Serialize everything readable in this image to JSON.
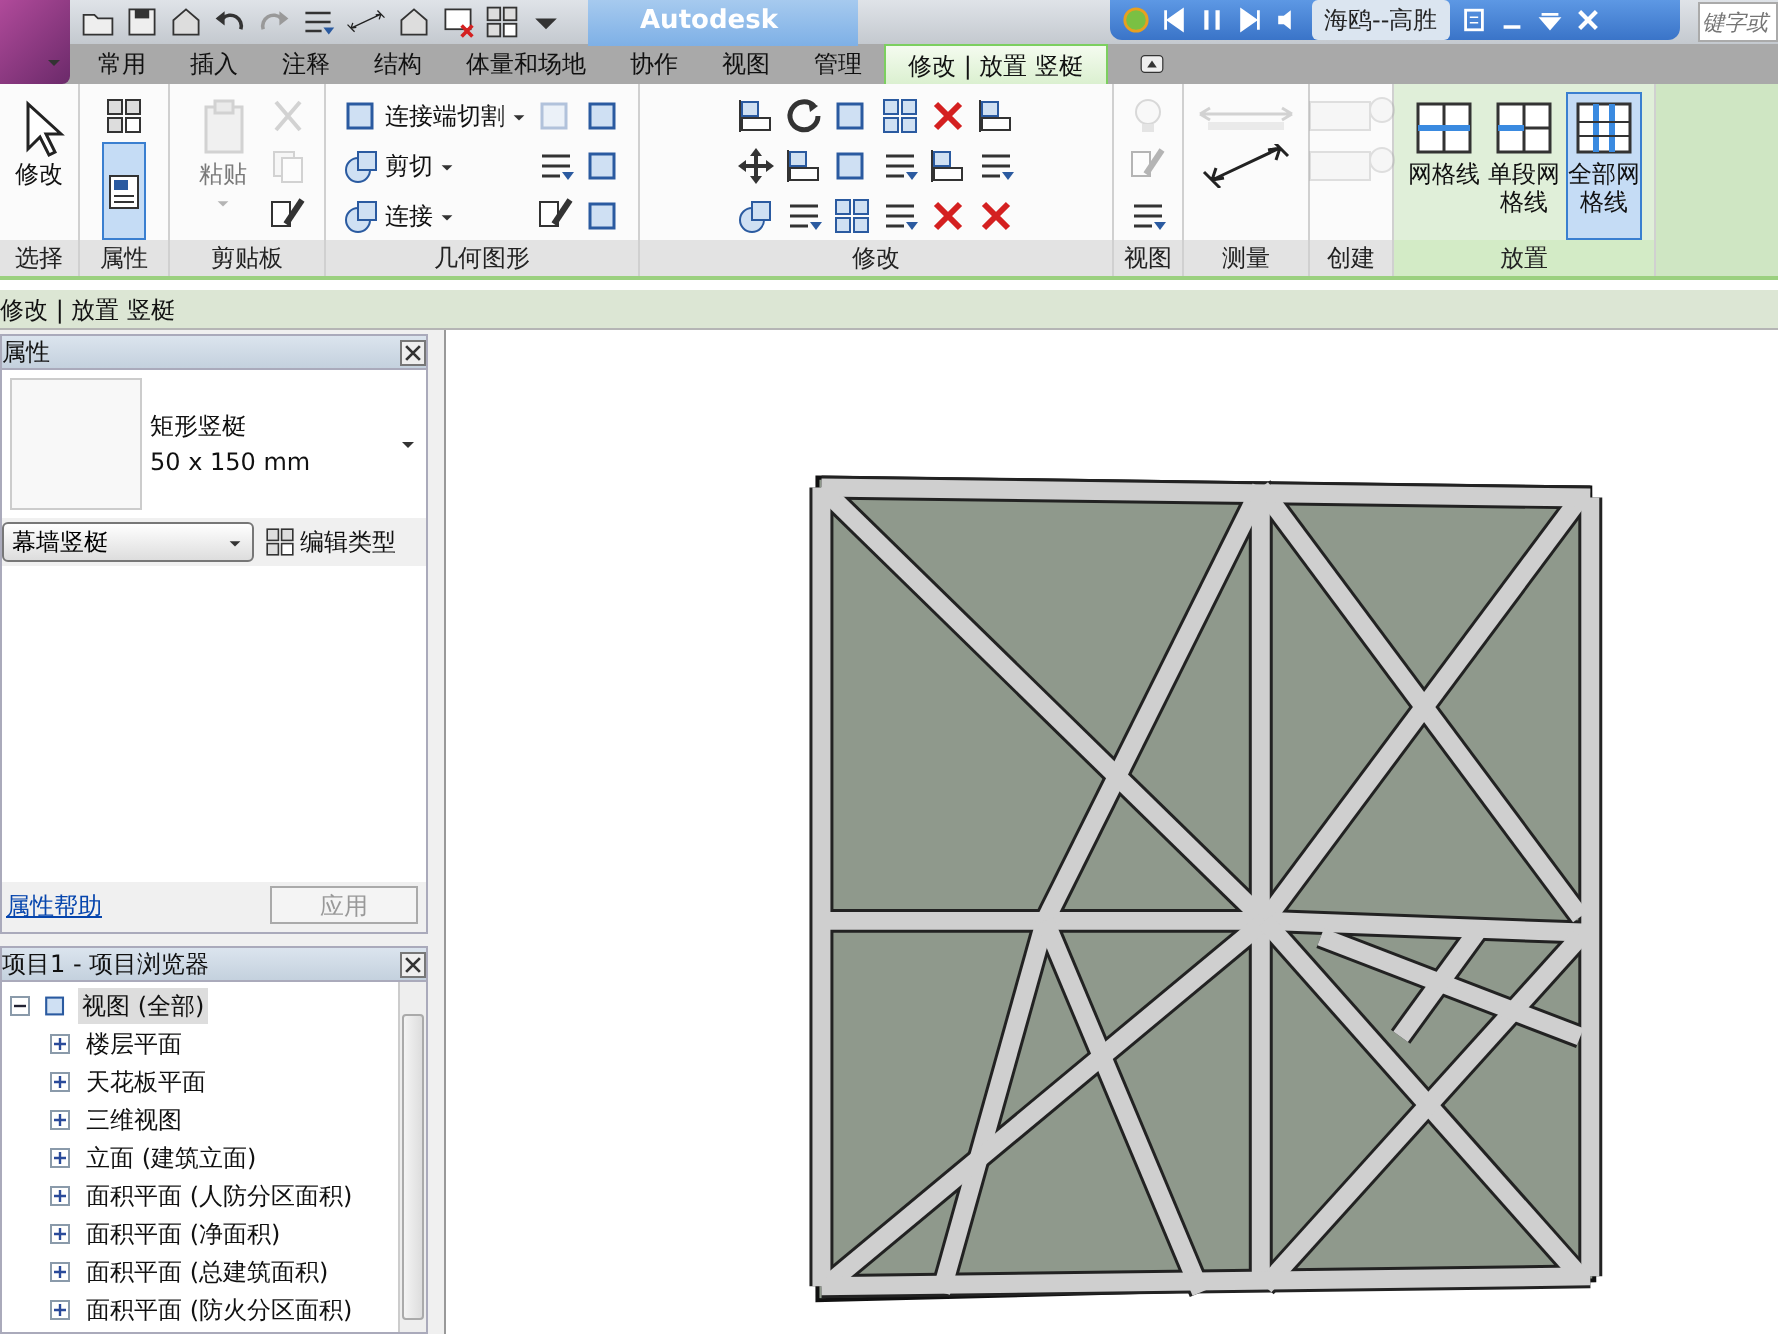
{
  "title_bar": {
    "title": "Autodesk",
    "search_placeholder": "键字或"
  },
  "media_player": {
    "track": "海鸥--高胜"
  },
  "tabs": [
    {
      "label": "常用",
      "selected": false
    },
    {
      "label": "插入",
      "selected": false
    },
    {
      "label": "注释",
      "selected": false
    },
    {
      "label": "结构",
      "selected": false
    },
    {
      "label": "体量和场地",
      "selected": false
    },
    {
      "label": "协作",
      "selected": false
    },
    {
      "label": "视图",
      "selected": false
    },
    {
      "label": "管理",
      "selected": false
    },
    {
      "label": "修改 | 放置 竖梃",
      "selected": true
    }
  ],
  "ribbon_panels": [
    {
      "label": "选择",
      "items": [
        {
          "kind": "large",
          "label": "修改",
          "disabled": false,
          "selected": false
        }
      ]
    },
    {
      "label": "属性",
      "items": [
        {
          "kind": "icon",
          "disabled": false,
          "selected": false
        },
        {
          "kind": "tall",
          "disabled": false,
          "selected": true
        }
      ]
    },
    {
      "label": "剪贴板",
      "items": [
        {
          "kind": "large",
          "label": "粘贴",
          "disabled": true,
          "selected": false
        },
        {
          "kind": "icon",
          "disabled": true,
          "selected": false
        },
        {
          "kind": "icon",
          "disabled": true,
          "selected": false
        },
        {
          "kind": "icon",
          "disabled": false,
          "selected": false
        }
      ]
    },
    {
      "label": "几何图形",
      "items": [
        {
          "kind": "small",
          "label": "连接端切割",
          "disabled": false,
          "selected": false
        },
        {
          "kind": "small",
          "label": "剪切",
          "disabled": false,
          "selected": false
        },
        {
          "kind": "small",
          "label": "连接",
          "disabled": false,
          "selected": false
        },
        {
          "kind": "icon",
          "disabled": true,
          "selected": false
        },
        {
          "kind": "icon",
          "disabled": false,
          "selected": false
        },
        {
          "kind": "icon",
          "disabled": false,
          "selected": false
        },
        {
          "kind": "icon",
          "disabled": false,
          "selected": false
        },
        {
          "kind": "icon",
          "disabled": false,
          "selected": false
        },
        {
          "kind": "icon",
          "disabled": false,
          "selected": false
        }
      ]
    },
    {
      "label": "修改",
      "items": [
        {
          "kind": "icon",
          "disabled": false,
          "selected": false
        },
        {
          "kind": "icon",
          "disabled": false,
          "selected": false
        },
        {
          "kind": "icon",
          "disabled": false,
          "selected": false
        },
        {
          "kind": "icon",
          "disabled": false,
          "selected": false
        },
        {
          "kind": "icon",
          "disabled": false,
          "selected": false
        },
        {
          "kind": "icon",
          "disabled": false,
          "selected": false
        },
        {
          "kind": "icon",
          "disabled": false,
          "selected": false
        },
        {
          "kind": "icon",
          "disabled": false,
          "selected": false
        },
        {
          "kind": "icon",
          "disabled": false,
          "selected": false
        },
        {
          "kind": "icon",
          "disabled": false,
          "selected": false
        },
        {
          "kind": "icon",
          "disabled": false,
          "selected": false
        },
        {
          "kind": "icon",
          "disabled": false,
          "selected": false
        },
        {
          "kind": "icon",
          "disabled": false,
          "selected": false
        },
        {
          "kind": "icon",
          "disabled": false,
          "selected": false
        },
        {
          "kind": "icon",
          "disabled": false,
          "selected": false
        },
        {
          "kind": "icon",
          "disabled": false,
          "selected": false
        },
        {
          "kind": "icon",
          "disabled": false,
          "selected": false
        },
        {
          "kind": "icon",
          "disabled": false,
          "selected": false
        }
      ]
    },
    {
      "label": "视图",
      "items": [
        {
          "kind": "icon",
          "disabled": true,
          "selected": false
        },
        {
          "kind": "icon",
          "disabled": true,
          "selected": false
        },
        {
          "kind": "icon",
          "disabled": false,
          "selected": false
        }
      ]
    },
    {
      "label": "测量",
      "items": [
        {
          "kind": "wide",
          "disabled": true,
          "selected": false
        },
        {
          "kind": "wide",
          "disabled": false,
          "selected": false
        }
      ]
    },
    {
      "label": "创建",
      "items": [
        {
          "kind": "wide",
          "disabled": true,
          "selected": false
        },
        {
          "kind": "wide",
          "disabled": true,
          "selected": false
        }
      ]
    },
    {
      "label": "放置",
      "items": [
        {
          "kind": "large",
          "label": "网格线",
          "disabled": false,
          "selected": false
        },
        {
          "kind": "large",
          "label": "单段网格线",
          "disabled": false,
          "selected": false
        },
        {
          "kind": "large",
          "label": "全部网格线",
          "disabled": false,
          "selected": true
        }
      ]
    }
  ],
  "context_bar": "修改 | 放置 竖梃",
  "properties": {
    "title": "属性",
    "type_name": "矩形竖梃",
    "type_size": "50 x 150 mm",
    "family": "幕墙竖梃",
    "edit_type": "编辑类型",
    "help": "属性帮助",
    "apply": {
      "label": "应用",
      "disabled": true
    }
  },
  "browser": {
    "title": "项目1 - 项目浏览器",
    "tree": [
      {
        "label": "视图 (全部)",
        "expanded": true,
        "selected": true,
        "children": [
          {
            "label": "楼层平面",
            "expanded": false,
            "selected": false
          },
          {
            "label": "天花板平面",
            "expanded": false,
            "selected": false
          },
          {
            "label": "三维视图",
            "expanded": false,
            "selected": false
          },
          {
            "label": "立面 (建筑立面)",
            "expanded": false,
            "selected": false
          },
          {
            "label": "面积平面 (人防分区面积)",
            "expanded": false,
            "selected": false
          },
          {
            "label": "面积平面 (净面积)",
            "expanded": false,
            "selected": false
          },
          {
            "label": "面积平面 (总建筑面积)",
            "expanded": false,
            "selected": false
          },
          {
            "label": "面积平面 (防火分区面积)",
            "expanded": false,
            "selected": false
          }
        ]
      }
    ]
  }
}
